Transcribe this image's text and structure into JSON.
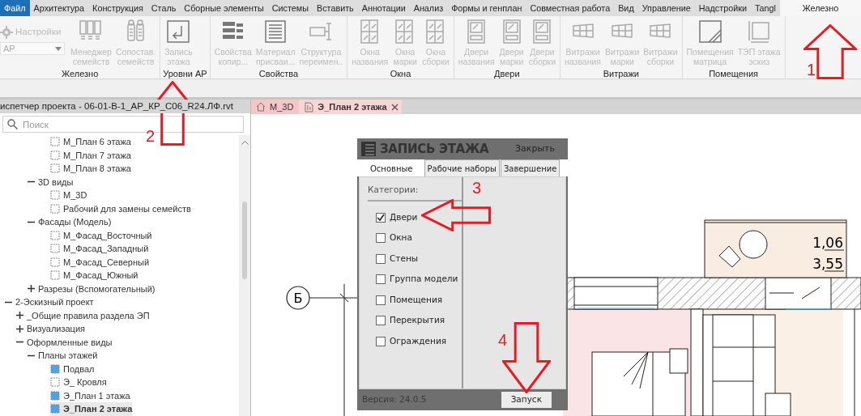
{
  "menu_tabs": [
    {
      "label": "Файл",
      "kind": "file",
      "selected": false
    },
    {
      "label": "Архитектура",
      "kind": "tab",
      "selected": false
    },
    {
      "label": "Конструкция",
      "kind": "tab",
      "selected": false
    },
    {
      "label": "Сталь",
      "kind": "tab",
      "selected": false
    },
    {
      "label": "Сборные элементы",
      "kind": "tab",
      "selected": false
    },
    {
      "label": "Системы",
      "kind": "tab",
      "selected": false
    },
    {
      "label": "Вставить",
      "kind": "tab",
      "selected": false
    },
    {
      "label": "Аннотации",
      "kind": "tab",
      "selected": false
    },
    {
      "label": "Анализ",
      "kind": "tab",
      "selected": false
    },
    {
      "label": "Формы и генплан",
      "kind": "tab",
      "selected": false
    },
    {
      "label": "Совместная работа",
      "kind": "tab",
      "selected": false
    },
    {
      "label": "Вид",
      "kind": "tab",
      "selected": false
    },
    {
      "label": "Управление",
      "kind": "tab",
      "selected": false
    },
    {
      "label": "Надстройки",
      "kind": "tab",
      "selected": false
    },
    {
      "label": "Tangl",
      "kind": "tab",
      "selected": false
    },
    {
      "label": "Железно",
      "kind": "tab",
      "selected": true
    }
  ],
  "ribbon": {
    "panels": [
      {
        "title": "Железно",
        "settings": {
          "label": "Настройки",
          "disabled": true
        },
        "dropdown": {
          "value": "АР"
        },
        "buttons": [
          {
            "lines": [
              "Менеджер",
              "семейств"
            ],
            "disabled": true
          },
          {
            "lines": [
              "Сопостав.",
              "семейств"
            ],
            "disabled": true
          }
        ]
      },
      {
        "title": "Уровни АР",
        "buttons": [
          {
            "lines": [
              "Запись",
              "этажа"
            ],
            "disabled": true
          }
        ]
      },
      {
        "title": "Свойства",
        "buttons": [
          {
            "lines": [
              "Свойства",
              "копир..."
            ],
            "disabled": true
          },
          {
            "lines": [
              "Материал",
              "присваи..."
            ],
            "disabled": true
          },
          {
            "lines": [
              "Структура",
              "переимен.."
            ],
            "disabled": true
          }
        ]
      },
      {
        "title": "Окна",
        "buttons": [
          {
            "lines": [
              "Окна",
              "названия"
            ],
            "disabled": true
          },
          {
            "lines": [
              "Окна",
              "марки"
            ],
            "disabled": true
          },
          {
            "lines": [
              "Окна",
              "сборки"
            ],
            "disabled": true
          }
        ]
      },
      {
        "title": "Двери",
        "buttons": [
          {
            "lines": [
              "Двери",
              "названия"
            ],
            "disabled": true
          },
          {
            "lines": [
              "Двери",
              "марки"
            ],
            "disabled": true
          },
          {
            "lines": [
              "Двери",
              "сборки"
            ],
            "disabled": true
          }
        ]
      },
      {
        "title": "Витражи",
        "buttons": [
          {
            "lines": [
              "Витражи",
              "названия"
            ],
            "disabled": true
          },
          {
            "lines": [
              "Витражи",
              "марки"
            ],
            "disabled": true
          },
          {
            "lines": [
              "Витражи",
              "сборки"
            ],
            "disabled": true
          }
        ]
      },
      {
        "title": "Помещения",
        "buttons": [
          {
            "lines": [
              "Помещения",
              "матрица"
            ],
            "disabled": true
          },
          {
            "lines": [
              "ТЭП этажа",
              "эскиз"
            ],
            "disabled": true
          }
        ]
      }
    ]
  },
  "project_browser": {
    "title": "испетчер проекта - 06-01-В-1_АР_КР_С06_R24.ЛФ.rvt",
    "search": {
      "placeholder": "Поиск"
    },
    "tree": [
      {
        "children": [
          {
            "children": [
              {
                "children": [
                  {
                    "label": "М_План 6 этажа",
                    "kind": "view",
                    "placed": false,
                    "selected": false
                  },
                  {
                    "label": "М_План 7 этажа",
                    "kind": "view",
                    "placed": false,
                    "selected": false
                  },
                  {
                    "label": "М_План 8 этажа",
                    "kind": "view",
                    "placed": false,
                    "selected": false
                  }
                ]
              },
              {
                "label": "3D виды",
                "kind": "group",
                "expanded": true,
                "selected": false,
                "children": [
                  {
                    "label": "М_3D",
                    "kind": "view",
                    "placed": false,
                    "selected": false
                  },
                  {
                    "label": "Рабочий для замены семейств",
                    "kind": "view",
                    "placed": false,
                    "selected": false
                  }
                ]
              },
              {
                "label": "Фасады (Модель)",
                "kind": "group",
                "expanded": true,
                "selected": false,
                "children": [
                  {
                    "label": "М_Фасад_Восточный",
                    "kind": "view",
                    "placed": false,
                    "selected": false
                  },
                  {
                    "label": "М_Фасад_Западный",
                    "kind": "view",
                    "placed": false,
                    "selected": false
                  },
                  {
                    "label": "М_Фасад_Северный",
                    "kind": "view",
                    "placed": false,
                    "selected": false
                  },
                  {
                    "label": "М_Фасад_Южный",
                    "kind": "view",
                    "placed": false,
                    "selected": false
                  }
                ]
              },
              {
                "label": "Разрезы (Вспомогательный)",
                "kind": "group",
                "expanded": false,
                "selected": false
              }
            ]
          }
        ]
      },
      {
        "label": "2-Эскизный проект",
        "kind": "group",
        "expanded": true,
        "selected": false,
        "children": [
          {
            "label": "_Общие правила раздела ЭП",
            "kind": "group",
            "expanded": false,
            "selected": false
          },
          {
            "label": "Визуализация",
            "kind": "group",
            "expanded": false,
            "selected": false
          },
          {
            "label": "Оформленные виды",
            "kind": "group",
            "expanded": true,
            "selected": false,
            "children": [
              {
                "label": "Планы этажей",
                "kind": "group",
                "expanded": true,
                "selected": false,
                "children": [
                  {
                    "label": "Подвал",
                    "kind": "view",
                    "placed": true,
                    "selected": false
                  },
                  {
                    "label": "Э_ Кровля",
                    "kind": "view",
                    "placed": false,
                    "selected": false
                  },
                  {
                    "label": "Э_План 1 этажа",
                    "kind": "view",
                    "placed": true,
                    "selected": false
                  },
                  {
                    "label": "Э_План 2 этажа",
                    "kind": "view",
                    "placed": true,
                    "selected": true
                  }
                ]
              }
            ]
          }
        ]
      }
    ]
  },
  "view_tabs": [
    {
      "label": "М_3D",
      "kind": "model",
      "selected": false
    },
    {
      "label": "Э_План 2 этажа",
      "kind": "plan",
      "selected": true
    }
  ],
  "plan": {
    "grid_label": "Б",
    "room_tag": [
      "1,06",
      "3,55"
    ]
  },
  "dialog": {
    "title": "ЗАПИСЬ ЭТАЖА",
    "close_label": "Закрыть",
    "tabs": [
      {
        "label": "Основные",
        "selected": true
      },
      {
        "label": "Рабочие наборы",
        "selected": false
      },
      {
        "label": "Завершение",
        "selected": false
      }
    ],
    "section_label": "Категории:",
    "categories": [
      {
        "label": "Двери",
        "checked": true
      },
      {
        "label": "Окна",
        "checked": false
      },
      {
        "label": "Стены",
        "checked": false
      },
      {
        "label": "Группа модели",
        "checked": false
      },
      {
        "label": "Помещения",
        "checked": false
      },
      {
        "label": "Перекрытия",
        "checked": false
      },
      {
        "label": "Ограждения",
        "checked": false
      }
    ],
    "version": "Версия: 24.0.5",
    "run_button": "Запуск"
  },
  "annotations": [
    {
      "number": "1",
      "kind": "up"
    },
    {
      "number": "2",
      "kind": "up"
    },
    {
      "number": "3",
      "kind": "left"
    },
    {
      "number": "4",
      "kind": "down"
    }
  ]
}
